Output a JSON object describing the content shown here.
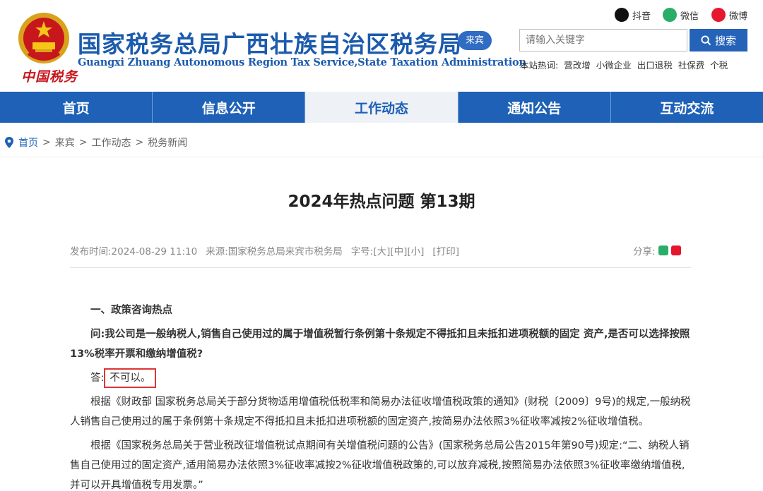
{
  "header": {
    "slogan": "中国税务",
    "site_title": "国家税务总局广西壮族自治区税务局",
    "city_badge": "来宾",
    "site_subtitle": "Guangxi Zhuang Autonomous Region Tax Service,State Taxation Administration",
    "social": [
      {
        "icon": "douyin-icon",
        "label": "抖音"
      },
      {
        "icon": "wechat-icon",
        "label": "微信"
      },
      {
        "icon": "weibo-icon",
        "label": "微博"
      }
    ],
    "search": {
      "placeholder": "请输入关键字",
      "button_label": "搜索"
    },
    "hot_words": {
      "label": "本站热词:",
      "items": [
        "营改增",
        "小微企业",
        "出口退税",
        "社保费",
        "个税"
      ]
    }
  },
  "nav": {
    "items": [
      "首页",
      "信息公开",
      "工作动态",
      "通知公告",
      "互动交流"
    ],
    "active": "工作动态"
  },
  "breadcrumb": {
    "items": [
      "首页",
      "来宾",
      "工作动态",
      "税务新闻"
    ],
    "separator": ">"
  },
  "article": {
    "title": "2024年热点问题 第13期",
    "meta": {
      "publish_time": "发布时间:2024-08-29 11:10",
      "source": "来源:国家税务总局来宾市税务局",
      "font_size": "字号:[大][中][小]",
      "print": "[打印]"
    },
    "share_label": "分享:",
    "section_heading": "一、政策咨询热点",
    "question": "问:我公司是一般纳税人,销售自己使用过的属于增值税暂行条例第十条规定不得抵扣且未抵扣进项税额的固定 资产,是否可以选择按照13%税率开票和缴纳增值税?",
    "answer_label": "答:",
    "answer_value": "不可以。",
    "paragraphs": [
      "根据《财政部 国家税务总局关于部分货物适用增值税低税率和简易办法征收增值税政策的通知》(财税〔2009〕9号)的规定,一般纳税人销售自己使用过的属于条例第十条规定不得抵扣且未抵扣进项税额的固定资产,按简易办法依照3%征收率减按2%征收增值税。",
      "根据《国家税务总局关于营业税改征增值税试点期间有关增值税问题的公告》(国家税务总局公告2015年第90号)规定:“二、纳税人销售自己使用过的固定资产,适用简易办法依照3%征收率减按2%征收增值税政策的,可以放弃减税,按照简易办法依照3%征收率缴纳增值税,并可以开具增值税专用发票。”"
    ]
  },
  "colors": {
    "brand_blue": "#1e61b6",
    "title_blue": "#1c5bad",
    "red": "#c8161d",
    "highlight_border": "#e03434"
  }
}
